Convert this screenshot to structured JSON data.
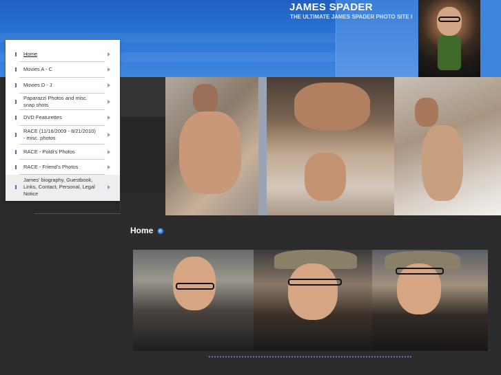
{
  "header": {
    "title": "JAMES SPADER",
    "subtitle": "THE ULTIMATE JAMES SPADER PHOTO SITE I"
  },
  "nav": {
    "items": [
      {
        "label": "Home",
        "active": true
      },
      {
        "label": "Movies A - C"
      },
      {
        "label": "Movies D - J"
      },
      {
        "label": "Paparazzi Photos and misc. snap shots"
      },
      {
        "label": "DVD Featurettes"
      },
      {
        "label": "RACE (11/16/2009 - 8/21/2010) - misc. photos"
      },
      {
        "label": "RACE - Poldi's Photos"
      },
      {
        "label": "RACE - Friend's Photos"
      },
      {
        "label": "James' biography, Guestbook, Links, Contact, Personal, Legal Notice"
      }
    ]
  },
  "main": {
    "heading": "Home"
  },
  "colors": {
    "banner_blue": "#2a74d6",
    "page_bg": "#2c2c2c",
    "dots": "#6a8fd0"
  }
}
